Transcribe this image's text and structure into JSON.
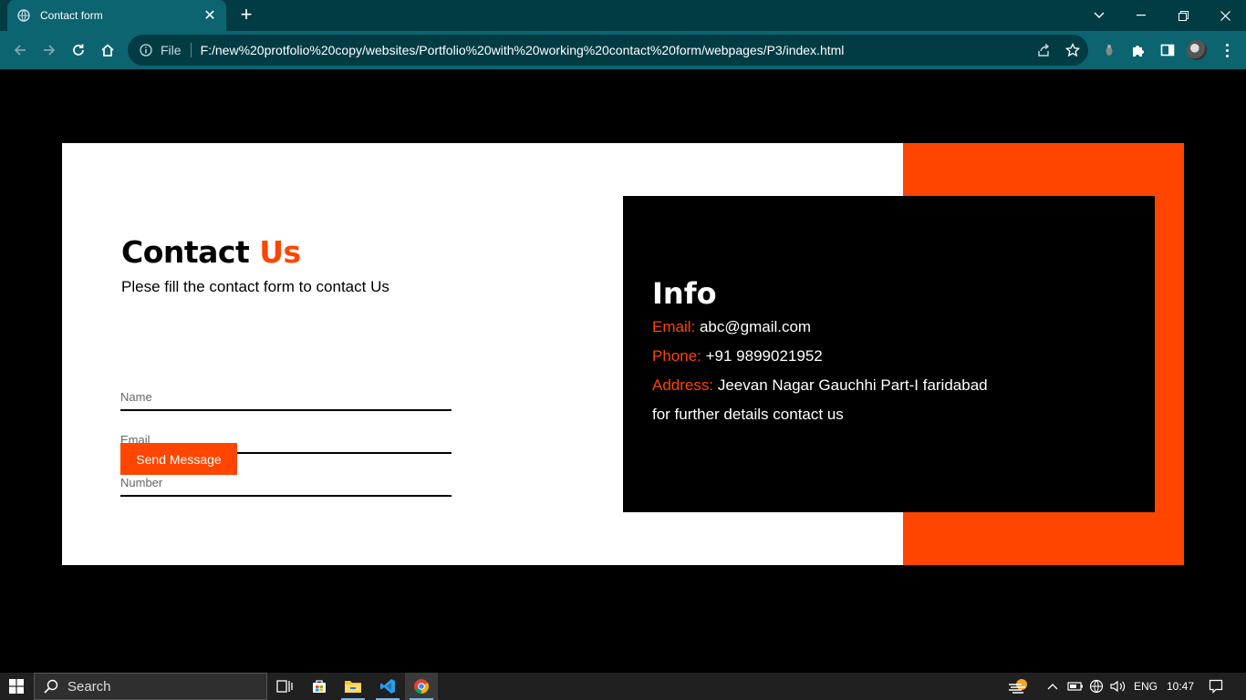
{
  "browser": {
    "tab_title": "Contact form",
    "url_scheme": "File",
    "url": "F:/new%20protfolio%20copy/websites/Portfolio%20with%20working%20contact%20form/webpages/P3/index.html"
  },
  "contact": {
    "heading_main": "Contact ",
    "heading_accent": "Us",
    "subtitle": "Plese fill the contact form to contact Us",
    "name_placeholder": "Name",
    "email_placeholder": "Email",
    "number_placeholder": "Number",
    "send_label": "Send Message"
  },
  "info": {
    "title": "Info",
    "email_label": "Email:",
    "email_value": "abc@gmail.com",
    "phone_label": "Phone:",
    "phone_value": "+91 9899021952",
    "address_label": "Address:",
    "address_value": "Jeevan Nagar Gauchhi Part-I faridabad",
    "footer": "for further details contact us"
  },
  "taskbar": {
    "search_label": "Search",
    "language": "ENG",
    "time": "10:47"
  },
  "colors": {
    "accent": "#ff4500",
    "chrome_dark": "#013c45",
    "chrome": "#0c6470"
  }
}
